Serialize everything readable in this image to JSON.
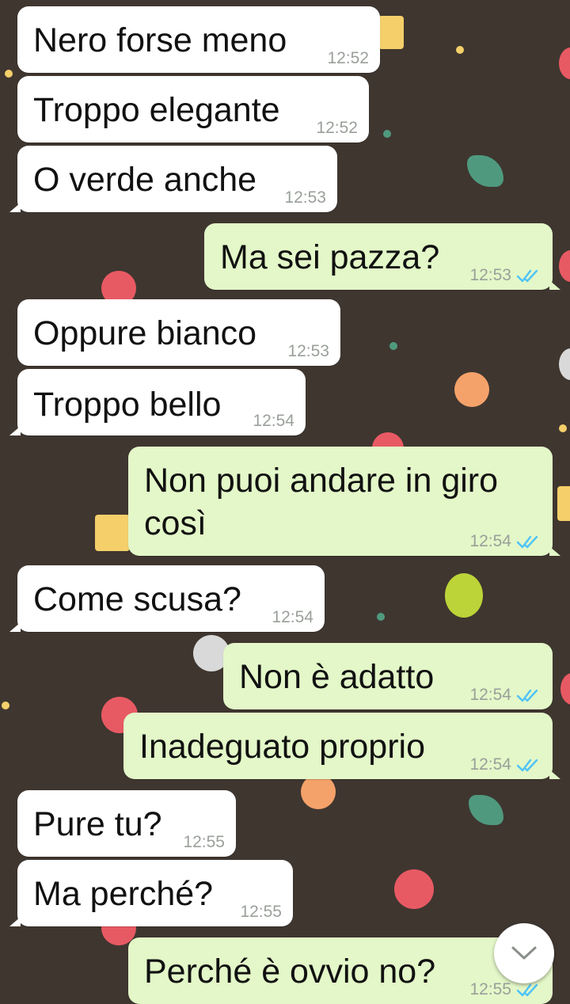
{
  "colors": {
    "wallpaper": "#3f3630",
    "incoming_bubble": "#ffffff",
    "outgoing_bubble": "#e3f7c8",
    "read_ticks": "#4fc3f7",
    "timestamp": "#9aa09a"
  },
  "wallpaper": {
    "icons": [
      "apple-icon",
      "orange-icon",
      "pear-icon",
      "house-icon",
      "leaf-icon",
      "berry-icon"
    ]
  },
  "messages": [
    {
      "direction": "in",
      "text": "Nero forse meno",
      "time": "12:52"
    },
    {
      "direction": "in",
      "text": "Troppo elegante",
      "time": "12:52"
    },
    {
      "direction": "in",
      "text": "O verde anche",
      "time": "12:53"
    },
    {
      "direction": "out",
      "text": "Ma sei pazza?",
      "time": "12:53",
      "read": true
    },
    {
      "direction": "in",
      "text": "Oppure bianco",
      "time": "12:53"
    },
    {
      "direction": "in",
      "text": "Troppo bello",
      "time": "12:54"
    },
    {
      "direction": "out",
      "text": "Non puoi andare in giro",
      "text2": "così",
      "time": "12:54",
      "read": true
    },
    {
      "direction": "in",
      "text": "Come scusa?",
      "time": "12:54"
    },
    {
      "direction": "out",
      "text": "Non è adatto",
      "time": "12:54",
      "read": true
    },
    {
      "direction": "out",
      "text": "Inadeguato proprio",
      "time": "12:54",
      "read": true
    },
    {
      "direction": "in",
      "text": "Pure tu?",
      "time": "12:55"
    },
    {
      "direction": "in",
      "text": "Ma perché?",
      "time": "12:55"
    },
    {
      "direction": "out",
      "text": "Perché è ovvio no?",
      "time": "12:55",
      "read": true
    }
  ],
  "scroll_button": {
    "icon": "chevron-down-icon"
  }
}
